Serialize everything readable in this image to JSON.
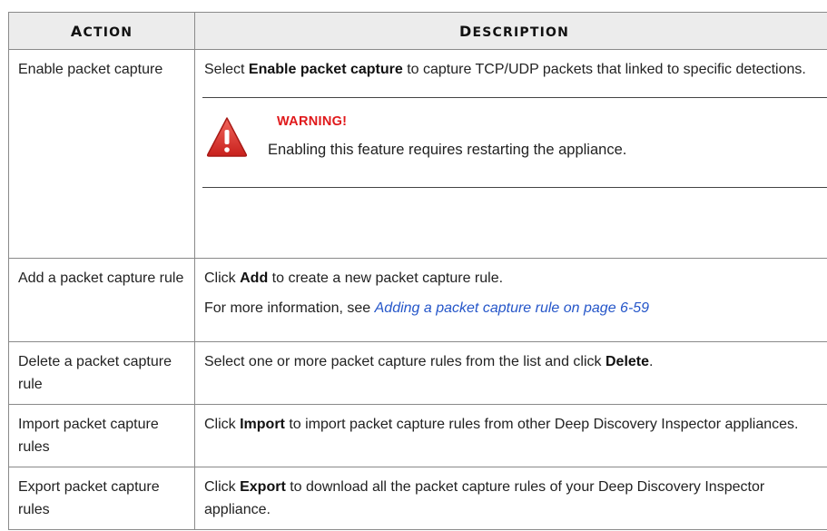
{
  "table": {
    "headers": {
      "action_first": "A",
      "action_rest": "CTION",
      "desc_first": "D",
      "desc_rest": "ESCRIPTION"
    },
    "rows": [
      {
        "action": "Enable packet capture",
        "desc_pre": "Select ",
        "desc_bold": "Enable packet capture",
        "desc_post": " to capture TCP/UDP packets that linked to specific detections.",
        "warning": {
          "icon": "warning-icon",
          "title": "WARNING!",
          "text": "Enabling this feature requires restarting the appliance."
        }
      },
      {
        "action": "Add a packet capture rule",
        "desc_pre": "Click ",
        "desc_bold": "Add",
        "desc_post": " to create a new packet capture rule.",
        "more_pre": "For more information, see ",
        "more_link": "Adding a packet capture rule on page 6-59"
      },
      {
        "action": "Delete a packet capture rule",
        "desc_pre": "Select one or more packet capture rules from the list and click ",
        "desc_bold": "Delete",
        "desc_post": "."
      },
      {
        "action": "Import packet capture rules",
        "desc_pre": "Click ",
        "desc_bold": "Import",
        "desc_post": " to import packet capture rules from other Deep Discovery Inspector appliances."
      },
      {
        "action": "Export packet capture rules",
        "desc_pre": "Click ",
        "desc_bold": "Export",
        "desc_post": " to download all the packet capture rules of your Deep Discovery Inspector appliance."
      }
    ]
  },
  "colors": {
    "warning_red": "#e0191b",
    "link_blue": "#2556c9",
    "header_bg": "#ececec"
  }
}
